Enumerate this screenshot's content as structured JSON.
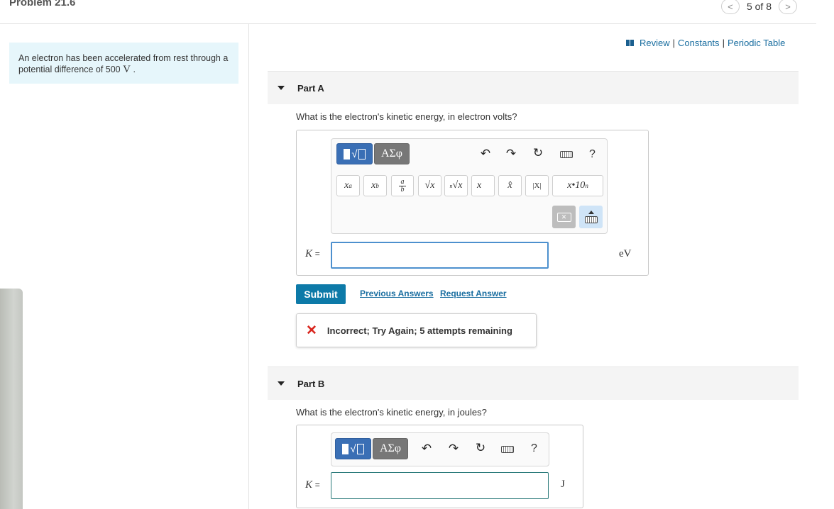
{
  "header": {
    "problem_title": "Problem 21.6",
    "pager_text": "5 of 8",
    "prev_icon": "chevron-left-icon",
    "next_icon": "chevron-right-icon"
  },
  "intro": {
    "text": "An electron has been accelerated from rest through a potential difference of 500",
    "value_unit": "V",
    "period": "."
  },
  "resources": {
    "icon": "book-icon",
    "review": "Review",
    "constants": "Constants",
    "periodic_table": "Periodic Table",
    "separator": "|"
  },
  "part_a": {
    "label": "Part A",
    "question": "What is the electron's kinetic energy, in electron volts?",
    "toolbar": {
      "greek_label": "ΑΣφ",
      "icons": [
        "undo-icon",
        "redo-icon",
        "reset-icon",
        "keyboard-icon",
        "help-icon"
      ],
      "help_label": "?",
      "symbols": [
        "xª",
        "x_b",
        "a/b",
        "√x",
        "ⁿ√x",
        "x⃗",
        "x̂",
        "|X|",
        "x·10ⁿ"
      ]
    },
    "input_label": "K",
    "equals": "=",
    "input_value": "",
    "unit": "eV",
    "submit_label": "Submit",
    "previous_answers": "Previous Answers",
    "request_answer": "Request Answer",
    "feedback": "Incorrect; Try Again; 5 attempts remaining"
  },
  "part_b": {
    "label": "Part B",
    "question": "What is the electron's kinetic energy, in joules?",
    "toolbar": {
      "greek_label": "ΑΣφ",
      "help_label": "?"
    },
    "input_label": "K",
    "equals": "=",
    "input_value": "",
    "unit": "J"
  },
  "colors": {
    "accent": "#0d7aa8",
    "link": "#1a6ea0",
    "error": "#d9251d",
    "intro_bg": "#e6f6fb"
  }
}
